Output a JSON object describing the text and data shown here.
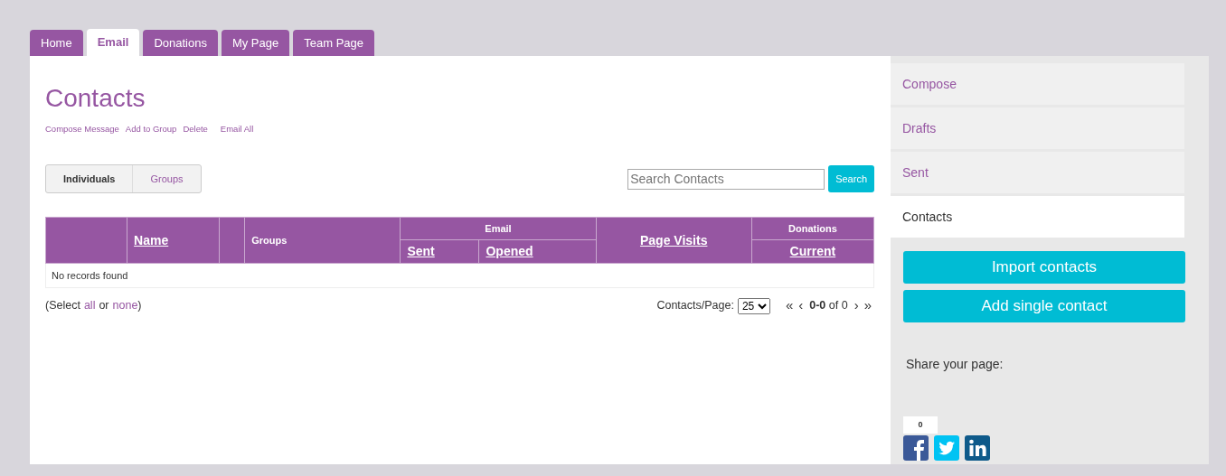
{
  "tabs": [
    {
      "label": "Home",
      "selected": false
    },
    {
      "label": "Email",
      "selected": true
    },
    {
      "label": "Donations",
      "selected": false
    },
    {
      "label": "My Page",
      "selected": false
    },
    {
      "label": "Team Page",
      "selected": false
    }
  ],
  "page_title": "Contacts",
  "actions": [
    "Compose Message",
    "Add to Group",
    "Delete",
    "Email All"
  ],
  "view_toggle": [
    {
      "label": "Individuals",
      "selected": true
    },
    {
      "label": "Groups",
      "selected": false
    }
  ],
  "search": {
    "placeholder": "Search Contacts",
    "button": "Search"
  },
  "table": {
    "name": "Name",
    "groups": "Groups",
    "email": {
      "label": "Email",
      "sent": "Sent",
      "opened": "Opened"
    },
    "page_visits": "Page Visits",
    "donations": {
      "label": "Donations",
      "current": "Current"
    },
    "empty_message": "No records found"
  },
  "select": {
    "prefix": "(Select",
    "all": "all",
    "middle": "or",
    "none": "none",
    "suffix": ")"
  },
  "pager": {
    "label": "Contacts/Page:",
    "per_page": "25",
    "first": "«",
    "prev": "‹",
    "range": "**0-0** of 0",
    "next": "›",
    "last": "»"
  },
  "sidebar": {
    "items": [
      {
        "label": "Compose",
        "selected": false
      },
      {
        "label": "Drafts",
        "selected": false
      },
      {
        "label": "Sent",
        "selected": false
      },
      {
        "label": "Contacts",
        "selected": true
      }
    ],
    "buttons": [
      "Import contacts",
      "Add single contact"
    ],
    "share": {
      "label": "Share your page:",
      "count": "0"
    }
  }
}
